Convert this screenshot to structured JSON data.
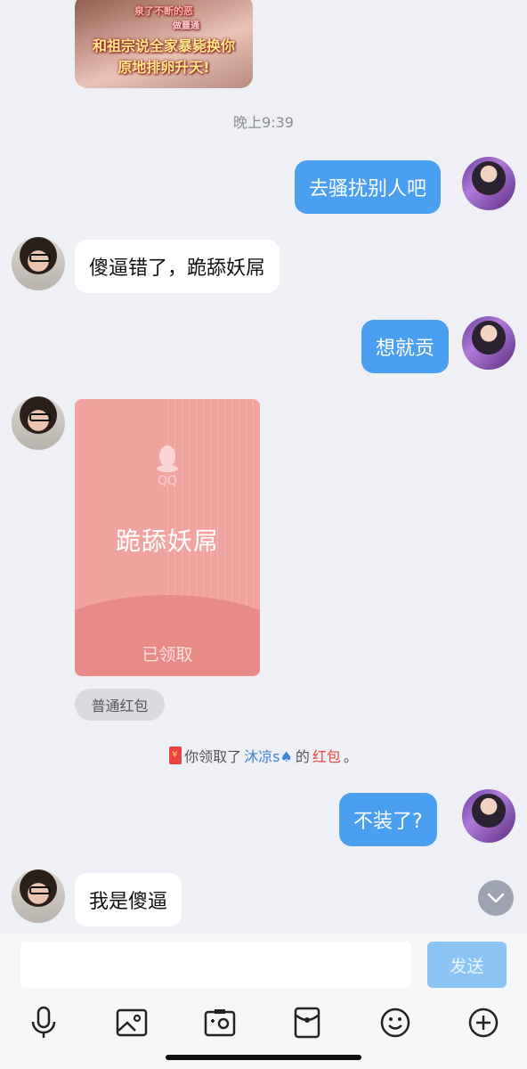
{
  "messages": {
    "image_caption": {
      "line1": "泉了不断的恶",
      "line2": "做噩通",
      "line3": "和祖宗说全家暴毙换你",
      "line4": "原地排卵升天!"
    },
    "time": "晚上9:39",
    "m1": "去骚扰别人吧",
    "m2": "傻逼错了，跪舔妖屌",
    "m3": "想就贡",
    "m5": "不装了?",
    "m6": "我是傻逼"
  },
  "red_packet": {
    "brand": "QQ",
    "title": "跪舔妖屌",
    "status": "已领取",
    "tag": "普通红包"
  },
  "notice": {
    "prefix": "你领取了",
    "name": "沐凉s♠",
    "mid": "的",
    "item": "红包",
    "suffix": "。"
  },
  "input": {
    "value": "",
    "send_label": "发送"
  },
  "toolbar": {
    "icons": [
      "microphone-icon",
      "photo-icon",
      "camera-icon",
      "red-packet-icon",
      "emoji-icon",
      "plus-icon"
    ]
  },
  "colors": {
    "self_bubble": "#4a9ff0",
    "other_bubble": "#ffffff",
    "background": "#eef0f5",
    "red_packet": "#f1a3a0",
    "send_disabled": "#8cc4f6"
  }
}
